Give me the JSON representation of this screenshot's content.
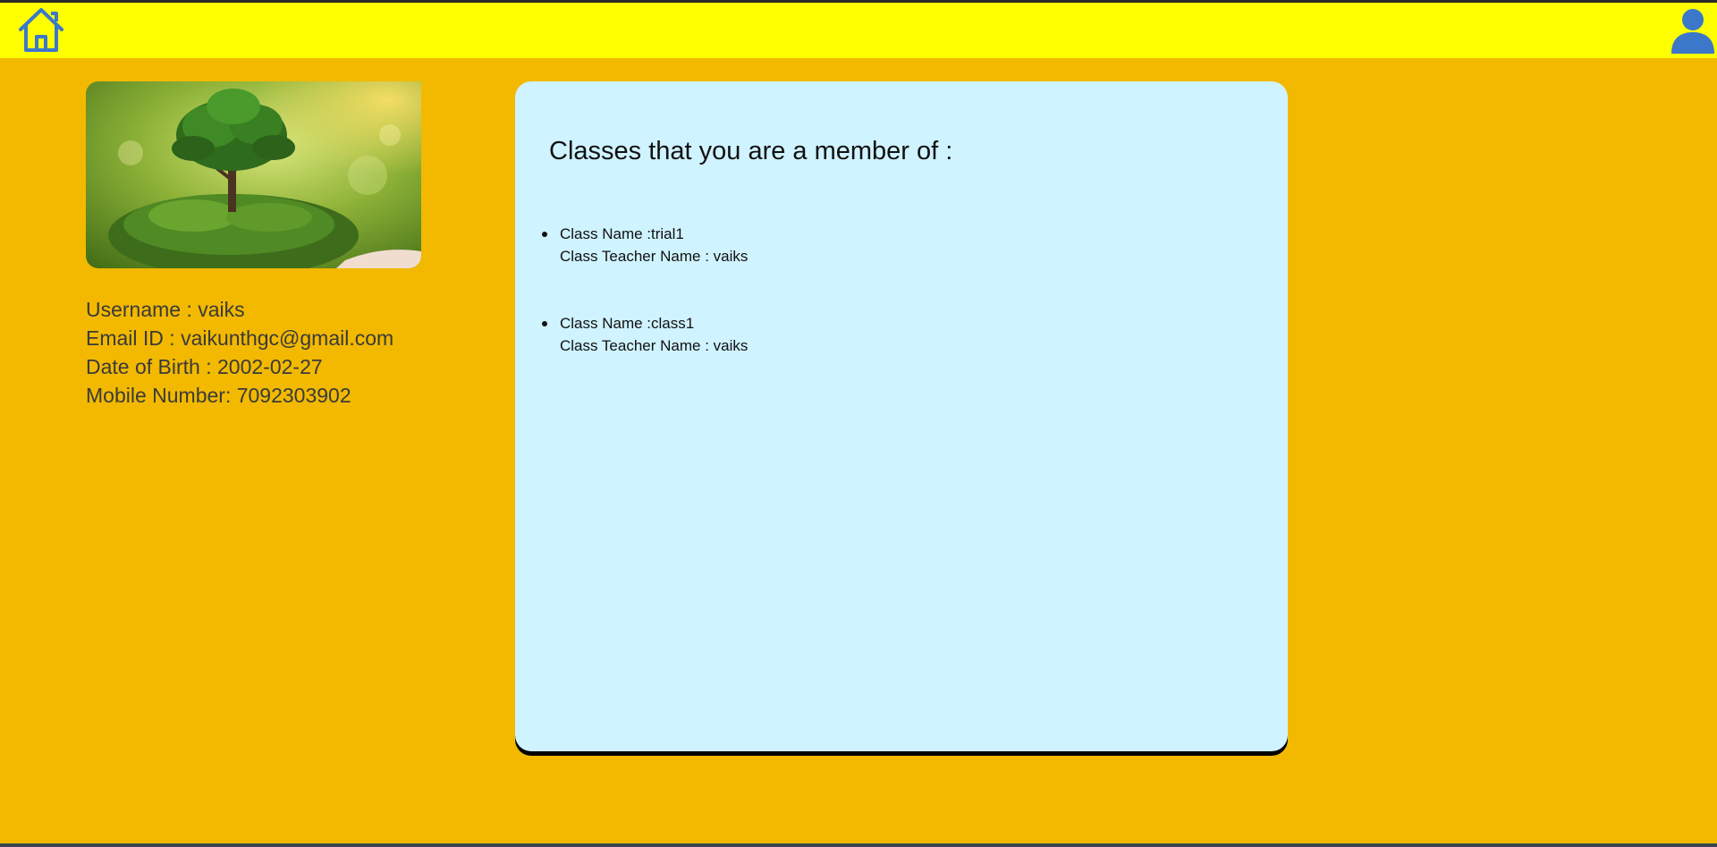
{
  "nav": {
    "home_icon": "home-icon",
    "profile_icon": "user-icon",
    "background": "#ffff00"
  },
  "page": {
    "background": "#f2b900"
  },
  "profile": {
    "image_subject": "tree-in-hand-photo",
    "username_line": "Username : vaiks",
    "email_line": "Email ID : vaikunthgc@gmail.com",
    "dob_line": "Date of Birth : 2002-02-27",
    "mobile_line": "Mobile Number: 7092303902"
  },
  "classes": {
    "title": "Classes that you are a member of :",
    "background": "#cff3ff",
    "items": [
      {
        "name_line": "Class Name :trial1",
        "teacher_line": "Class Teacher Name : vaiks"
      },
      {
        "name_line": "Class Name :class1",
        "teacher_line": "Class Teacher Name : vaiks"
      }
    ]
  }
}
